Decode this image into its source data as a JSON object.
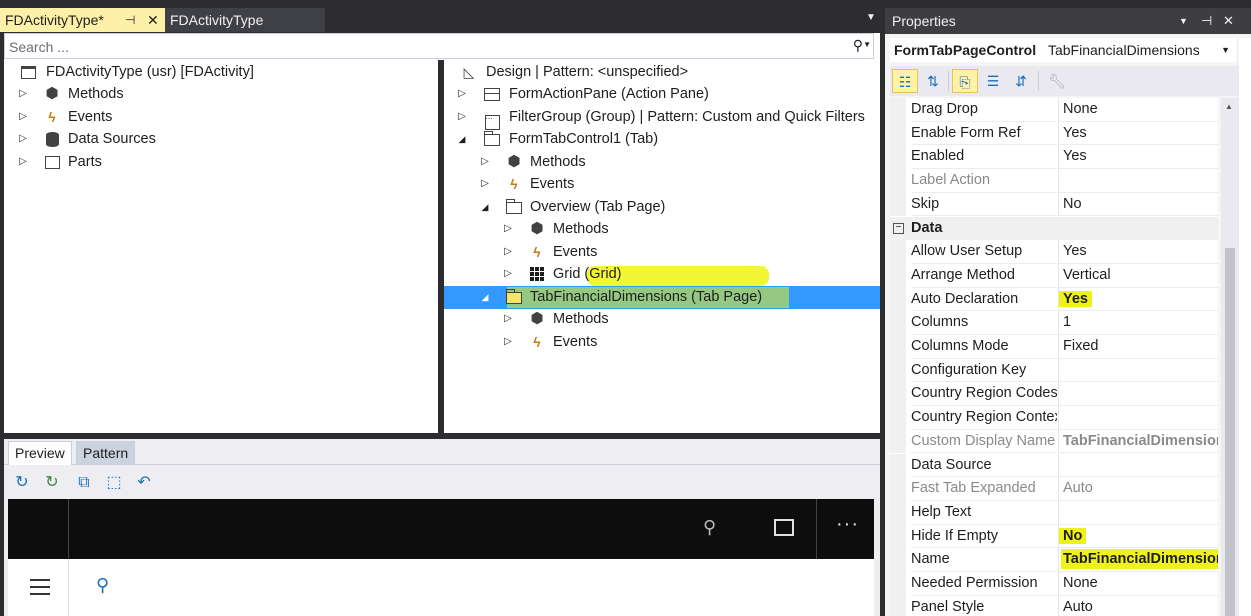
{
  "tabs": {
    "active_label": "FDActivityType*",
    "pin_glyph": "⊣",
    "close_glyph": "✕",
    "inactive_label": "FDActivityType"
  },
  "search": {
    "placeholder": "Search ..."
  },
  "left_tree": {
    "root": "FDActivityType (usr) [FDActivity]",
    "items": [
      {
        "label": "Methods",
        "icon": "cubes-icon"
      },
      {
        "label": "Events",
        "icon": "bolt-icon"
      },
      {
        "label": "Data Sources",
        "icon": "database-icon"
      },
      {
        "label": "Parts",
        "icon": "window-icon"
      }
    ]
  },
  "right_tree": {
    "design": "Design | Pattern: <unspecified>",
    "action_pane": "FormActionPane (Action Pane)",
    "filter_group": "FilterGroup (Group) | Pattern: Custom and Quick Filters",
    "tab_control": "FormTabControl1 (Tab)",
    "tab_methods": "Methods",
    "tab_events": "Events",
    "overview": "Overview (Tab Page)",
    "overview_methods": "Methods",
    "overview_events": "Events",
    "grid": "Grid (Grid)",
    "tabfin": "TabFinancialDimensions (Tab Page)",
    "tabfin_methods": "Methods",
    "tabfin_events": "Events"
  },
  "preview": {
    "tab_preview": "Preview",
    "tab_pattern": "Pattern"
  },
  "properties": {
    "title": "Properties",
    "selected_type": "FormTabPageControl",
    "selected_name": "TabFinancialDimensions",
    "rows": [
      {
        "name": "Drag Drop",
        "value": "None"
      },
      {
        "name": "Enable Form Ref",
        "value": "Yes"
      },
      {
        "name": "Enabled",
        "value": "Yes"
      },
      {
        "name": "Label Action",
        "value": ""
      },
      {
        "name": "Skip",
        "value": "No"
      },
      {
        "name": "Data",
        "value": ""
      },
      {
        "name": "Allow User Setup",
        "value": "Yes"
      },
      {
        "name": "Arrange Method",
        "value": "Vertical"
      },
      {
        "name": "Auto Declaration",
        "value": "Yes"
      },
      {
        "name": "Columns",
        "value": "1"
      },
      {
        "name": "Columns Mode",
        "value": "Fixed"
      },
      {
        "name": "Configuration Key",
        "value": ""
      },
      {
        "name": "Country Region Codes",
        "value": ""
      },
      {
        "name": "Country Region Context",
        "value": ""
      },
      {
        "name": "Custom Display Name",
        "value": "TabFinancialDimension"
      },
      {
        "name": "Data Source",
        "value": ""
      },
      {
        "name": "Fast Tab Expanded",
        "value": "Auto"
      },
      {
        "name": "Help Text",
        "value": ""
      },
      {
        "name": "Hide If Empty",
        "value": "No"
      },
      {
        "name": "Name",
        "value": "TabFinancialDimension"
      },
      {
        "name": "Needed Permission",
        "value": "None"
      },
      {
        "name": "Panel Style",
        "value": "Auto"
      }
    ]
  },
  "colors": {
    "selection": "#3399ff",
    "highlight": "#e8f21a",
    "active_tab": "#fff0a8",
    "chrome": "#2d2d30"
  }
}
